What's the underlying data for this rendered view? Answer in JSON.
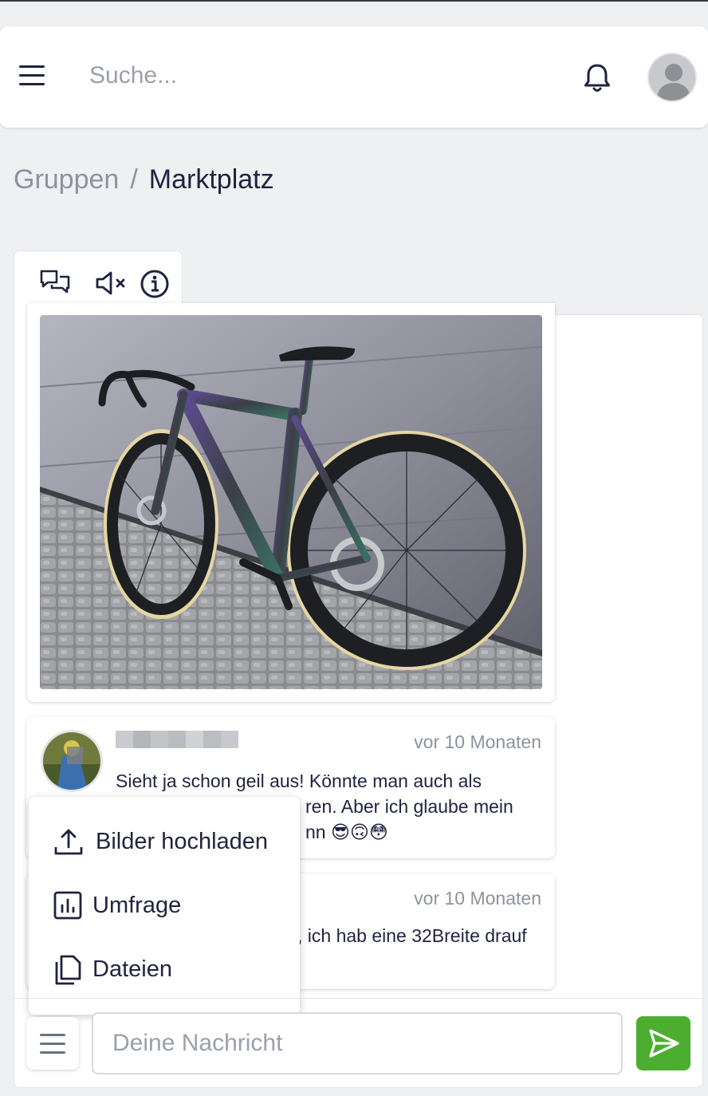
{
  "header": {
    "search_placeholder": "Suche..."
  },
  "breadcrumb": {
    "parent": "Gruppen",
    "separator": "/",
    "current": "Marktplatz"
  },
  "toolbar": {
    "icons": [
      "chat-bubbles-icon",
      "speaker-muted-icon",
      "info-icon"
    ]
  },
  "messages": [
    {
      "time": "vor 10 Monaten",
      "text": "Sieht ja schon geil aus! Könnte man auch als [obscured]ren. Aber ich glaube mein [obscured]nn 😎🙃😳",
      "line1": "Sieht ja schon geil aus! Könnte man auch als",
      "line2": "ren. Aber ich glaube mein",
      "line3": "nn 😎🙃😳"
    },
    {
      "time": "vor 10 Monaten",
      "line1": ", ich hab eine 32Breite drauf"
    }
  ],
  "attach_menu": {
    "items": [
      {
        "label": "Bilder hochladen",
        "icon": "upload-icon"
      },
      {
        "label": "Umfrage",
        "icon": "poll-chart-icon"
      },
      {
        "label": "Dateien",
        "icon": "files-icon"
      }
    ]
  },
  "composer": {
    "placeholder": "Deine Nachricht"
  },
  "colors": {
    "accent_send": "#4cae2f",
    "text_dark": "#1f2340",
    "text_muted": "#8d939d"
  }
}
